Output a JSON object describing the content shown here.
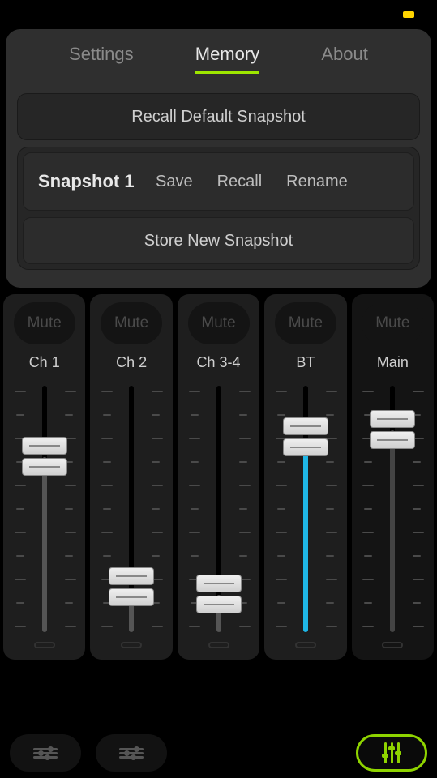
{
  "status": {
    "indicator_color": "#ffd400"
  },
  "modal": {
    "tabs": {
      "settings": "Settings",
      "memory": "Memory",
      "about": "About",
      "active": "memory"
    },
    "recall_default": "Recall Default Snapshot",
    "snapshot": {
      "name": "Snapshot 1",
      "save": "Save",
      "recall": "Recall",
      "rename": "Rename"
    },
    "store_new": "Store New Snapshot"
  },
  "mixer": {
    "mute_label": "Mute",
    "channels": [
      {
        "id": "ch1",
        "label": "Ch 1",
        "level": 0.71,
        "fill_color": "#555",
        "has_eq_below": true
      },
      {
        "id": "ch2",
        "label": "Ch 2",
        "level": 0.18,
        "fill_color": "#555",
        "has_eq_below": true
      },
      {
        "id": "ch34",
        "label": "Ch 3-4",
        "level": 0.15,
        "fill_color": "#555",
        "has_eq_below": false
      },
      {
        "id": "bt",
        "label": "BT",
        "level": 0.79,
        "fill_color": "#1fb6e6",
        "has_eq_below": false
      },
      {
        "id": "main",
        "label": "Main",
        "level": 0.82,
        "fill_color": "#444",
        "has_eq_below": false,
        "is_main": true
      }
    ]
  },
  "colors": {
    "accent": "#8fd400"
  }
}
